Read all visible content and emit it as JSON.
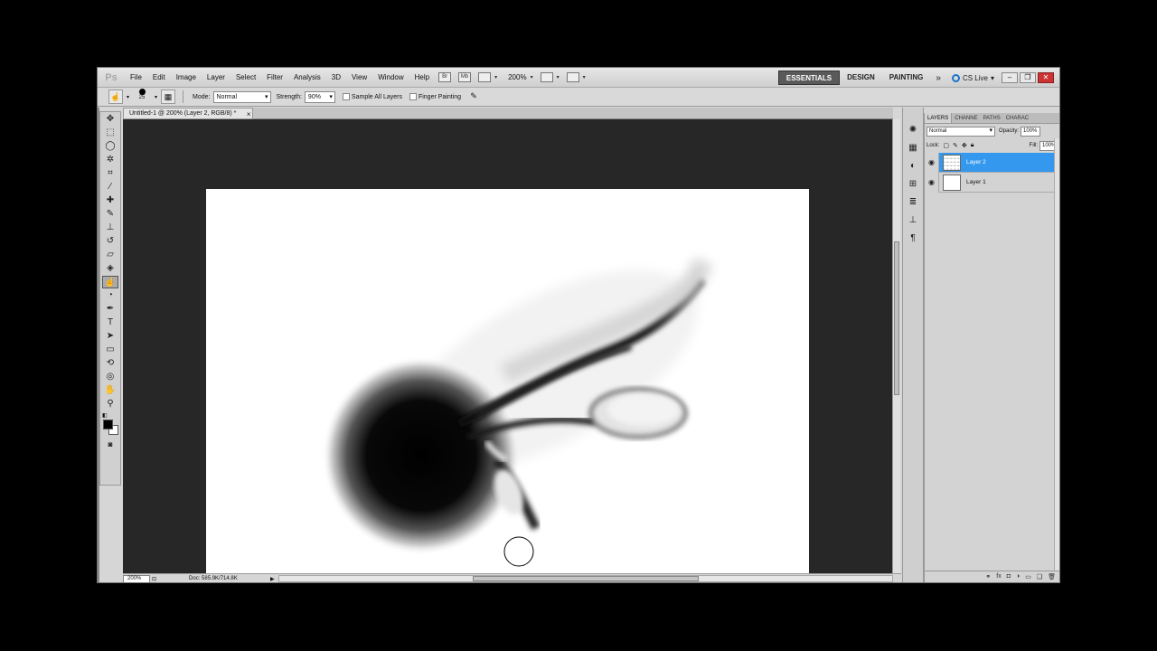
{
  "app": {
    "logo": "Ps"
  },
  "menu": [
    "File",
    "Edit",
    "Image",
    "Layer",
    "Select",
    "Filter",
    "Analysis",
    "3D",
    "View",
    "Window",
    "Help"
  ],
  "menubar_icons": {
    "bridge": "Br",
    "mini_bridge": "Mb"
  },
  "zoom_menu": "200%",
  "workspaces": {
    "essentials": "ESSENTIALS",
    "design": "DESIGN",
    "painting": "PAINTING",
    "more": "»"
  },
  "cs_live": "CS Live",
  "window_buttons": {
    "minimize": "–",
    "restore": "❐",
    "close": "✕"
  },
  "options": {
    "brush_size": "25",
    "mode_label": "Mode:",
    "mode_value": "Normal",
    "strength_label": "Strength:",
    "strength_value": "90%",
    "sample_all_layers": "Sample All Layers",
    "finger_painting": "Finger Painting"
  },
  "document_tab": {
    "title": "Untitled-1 @ 200% (Layer 2, RGB/8) *",
    "close": "×"
  },
  "status": {
    "zoom": "200%",
    "doc_size": "Doc: 585.9K/714.8K"
  },
  "layers_panel": {
    "tabs": [
      "LAYERS",
      "CHANNE",
      "PATHS",
      "CHARAC"
    ],
    "blend_mode": "Normal",
    "opacity_label": "Opacity:",
    "opacity_value": "100%",
    "lock_label": "Lock:",
    "fill_label": "Fill:",
    "fill_value": "100%",
    "layers": [
      {
        "name": "Layer 2",
        "selected": true
      },
      {
        "name": "Layer 1",
        "selected": false
      }
    ]
  },
  "colors": {
    "selection_blue": "#3398ee",
    "canvas_bg": "#272727",
    "active_workspace": "#5a5a5a"
  },
  "icons": {
    "tools": [
      "move-icon",
      "marquee-icon",
      "lasso-icon",
      "quick-select-icon",
      "crop-icon",
      "eyedropper-icon",
      "healing-brush-icon",
      "brush-icon",
      "clone-stamp-icon",
      "history-brush-icon",
      "eraser-icon",
      "gradient-icon",
      "smudge-icon",
      "dodge-icon",
      "pen-icon",
      "type-icon",
      "path-select-icon",
      "shape-icon",
      "3d-rotate-icon",
      "3d-orbit-icon",
      "hand-icon",
      "zoom-icon"
    ],
    "dock": [
      "color-icon",
      "swatches-icon",
      "adjustments-icon",
      "masks-icon",
      "brushes-icon",
      "clone-source-icon",
      "paragraph-icon"
    ]
  }
}
